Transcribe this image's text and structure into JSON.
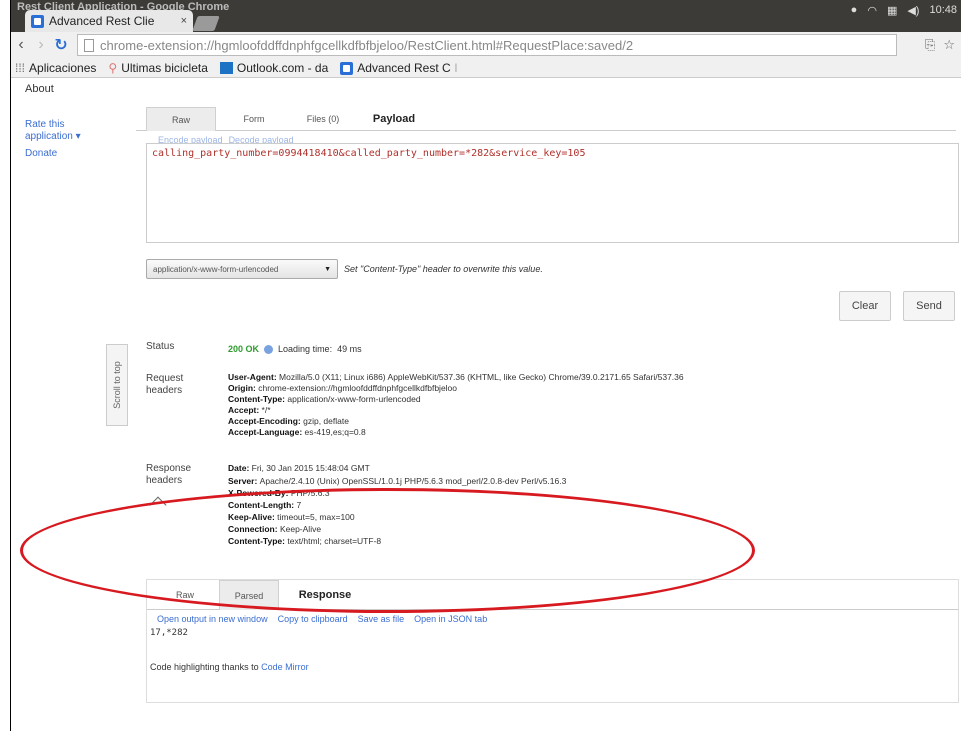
{
  "window": {
    "title": "Rest Client Application - Google Chrome",
    "tray_time": "10:48"
  },
  "tab": {
    "title": "Advanced Rest Clie",
    "close": "×"
  },
  "toolbar": {
    "url": "chrome-extension://hgmloofddffdnphfgcellkdfbfbjeloo/RestClient.html#RequestPlace:saved/2"
  },
  "bookmarks": [
    {
      "label": "Aplicaciones",
      "faded": ""
    },
    {
      "label": "Ultimas bicicleta",
      "faded": ""
    },
    {
      "label": "Outlook.com - da",
      "faded": ""
    },
    {
      "label": "Advanced Rest C",
      "faded": "l"
    }
  ],
  "sidebar": {
    "about": "About",
    "rate_line1": "Rate this",
    "rate_line2": "application ▾",
    "donate": "Donate",
    "scroll_to_top": "Scroll to top"
  },
  "request": {
    "tabs": [
      "Raw",
      "Form",
      "Files (0)",
      "Payload"
    ],
    "encode": "Encode payload",
    "decode": "Decode payload",
    "payload": "calling_party_number=0994418410&called_party_number=*282&service_key=105",
    "content_type": "application/x-www-form-urlencoded",
    "content_type_hint": "Set \"Content-Type\" header to overwrite this value.",
    "clear": "Clear",
    "send": "Send"
  },
  "response": {
    "status_label": "Status",
    "status_code": "200 OK",
    "loading_label": "Loading time:",
    "loading_value": "49 ms",
    "request_headers_label1": "Request",
    "request_headers_label2": "headers",
    "request_headers": [
      {
        "name": "User-Agent",
        "value": "Mozilla/5.0 (X11; Linux i686) AppleWebKit/537.36 (KHTML, like Gecko) Chrome/39.0.2171.65 Safari/537.36"
      },
      {
        "name": "Origin",
        "value": "chrome-extension://hgmloofddffdnphfgcellkdfbfbjeloo"
      },
      {
        "name": "Content-Type",
        "value": "application/x-www-form-urlencoded"
      },
      {
        "name": "Accept",
        "value": "*/*"
      },
      {
        "name": "Accept-Encoding",
        "value": "gzip, deflate"
      },
      {
        "name": "Accept-Language",
        "value": "es-419,es;q=0.8"
      }
    ],
    "response_headers_label1": "Response",
    "response_headers_label2": "headers",
    "response_headers": [
      {
        "name": "Date",
        "value": "Fri, 30 Jan 2015 15:48:04 GMT"
      },
      {
        "name": "Server",
        "value": "Apache/2.4.10 (Unix) OpenSSL/1.0.1j PHP/5.6.3 mod_perl/2.0.8-dev Perl/v5.16.3"
      },
      {
        "name": "X-Powered-By",
        "value": "PHP/5.6.3"
      },
      {
        "name": "Content-Length",
        "value": "7"
      },
      {
        "name": "Keep-Alive",
        "value": "timeout=5, max=100"
      },
      {
        "name": "Connection",
        "value": "Keep-Alive"
      },
      {
        "name": "Content-Type",
        "value": "text/html; charset=UTF-8"
      }
    ],
    "tabs": [
      "Raw",
      "Parsed",
      "Response"
    ],
    "links": [
      "Open output in new window",
      "Copy to clipboard",
      "Save as file",
      "Open in JSON tab"
    ],
    "output": "17,*282",
    "footer_text": "Code highlighting thanks to",
    "footer_link": "Code Mirror"
  },
  "colors": {
    "annotation": "#d71920",
    "status_ok": "#2e9b2e",
    "link": "#3b6ed1"
  }
}
